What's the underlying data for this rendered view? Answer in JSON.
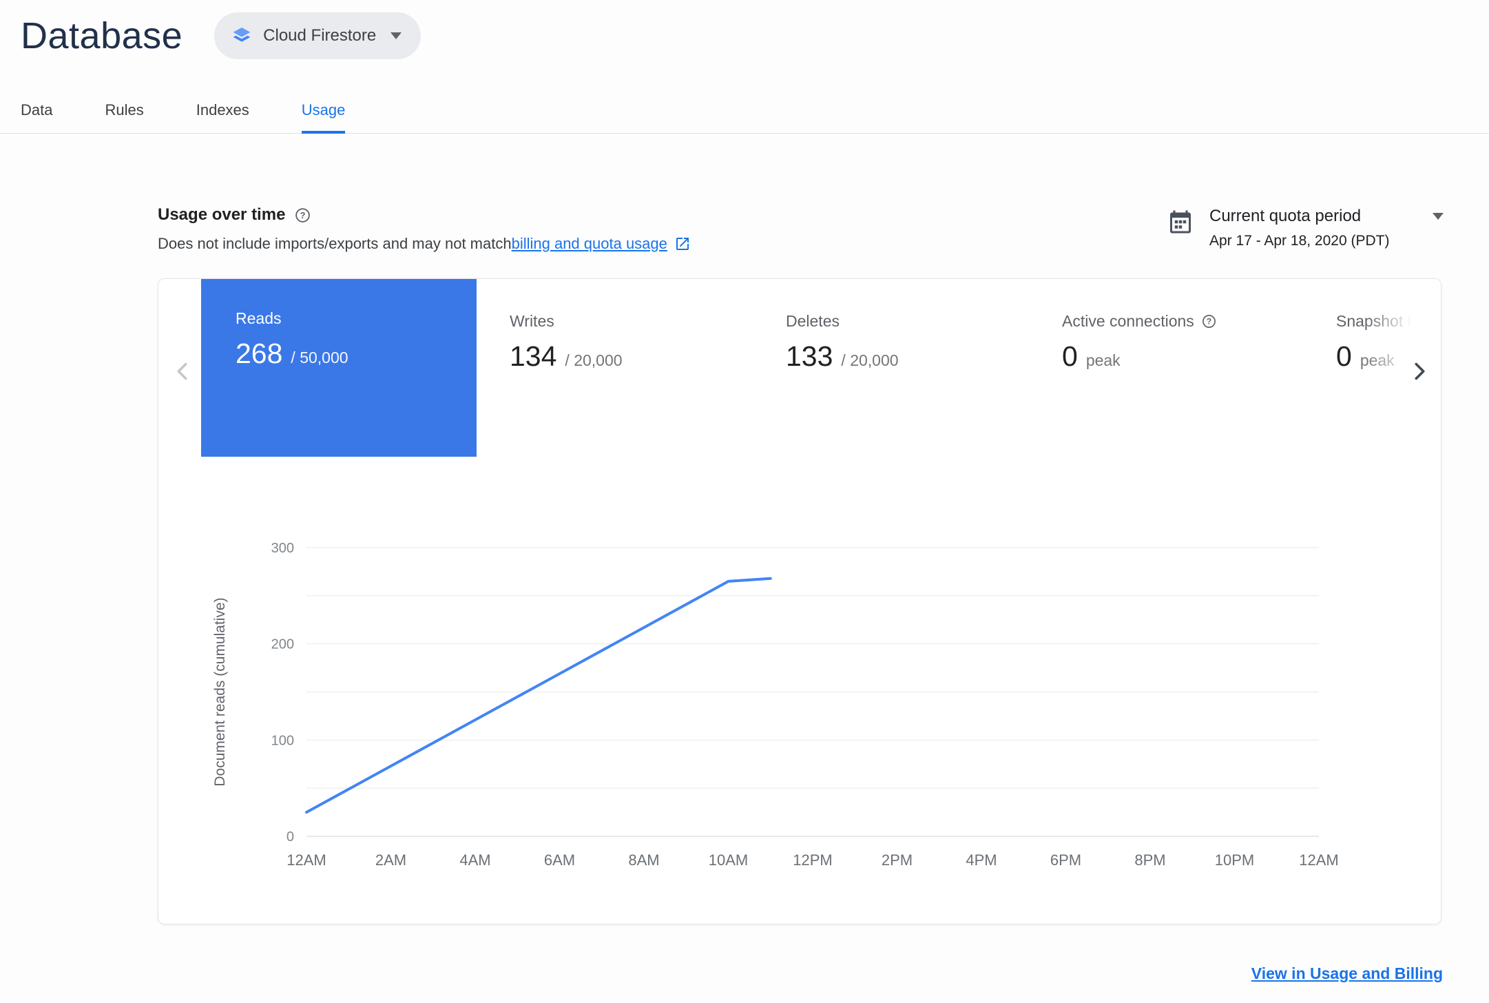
{
  "colors": {
    "accent_blue": "#1a73e8",
    "tile_blue": "#3b78e7",
    "chart_line": "#4285f4"
  },
  "header": {
    "title": "Database",
    "product_selector": {
      "label": "Cloud Firestore",
      "icon": "firestore-icon"
    }
  },
  "tabs": [
    {
      "label": "Data",
      "active": false
    },
    {
      "label": "Rules",
      "active": false
    },
    {
      "label": "Indexes",
      "active": false
    },
    {
      "label": "Usage",
      "active": true
    }
  ],
  "usage_section": {
    "title": "Usage over time",
    "subtitle_prefix": "Does not include imports/exports and may not match ",
    "subtitle_link": "billing and quota usage",
    "period_selector": {
      "icon": "calendar-icon",
      "label": "Current quota period",
      "range": "Apr 17 - Apr 18, 2020 (PDT)"
    }
  },
  "metrics": [
    {
      "label": "Reads",
      "value": "268",
      "limit": "/ 50,000",
      "selected": true
    },
    {
      "label": "Writes",
      "value": "134",
      "limit": "/ 20,000",
      "selected": false
    },
    {
      "label": "Deletes",
      "value": "133",
      "limit": "/ 20,000",
      "selected": false
    },
    {
      "label": "Active connections",
      "value": "0",
      "limit": "peak",
      "selected": false
    },
    {
      "label": "Snapshot listeners",
      "value": "0",
      "limit": "peak",
      "selected": false
    }
  ],
  "chart_data": {
    "type": "line",
    "title": "",
    "xlabel": "",
    "ylabel": "Document reads (cumulative)",
    "x_ticks": [
      "12AM",
      "2AM",
      "4AM",
      "6AM",
      "8AM",
      "10AM",
      "12PM",
      "2PM",
      "4PM",
      "6PM",
      "8PM",
      "10PM",
      "12AM"
    ],
    "y_ticks": [
      0,
      100,
      200,
      300
    ],
    "ylim": [
      0,
      300
    ],
    "xlim_hours": [
      0,
      24
    ],
    "grid_interval": 50,
    "grid": "on",
    "legend": "none",
    "line_color": "#4285f4",
    "series": [
      {
        "name": "Document reads (cumulative)",
        "points": [
          {
            "x": 0,
            "y": 25
          },
          {
            "x": 10,
            "y": 265
          },
          {
            "x": 11,
            "y": 268
          }
        ]
      }
    ]
  },
  "footer": {
    "link": "View in Usage and Billing"
  }
}
